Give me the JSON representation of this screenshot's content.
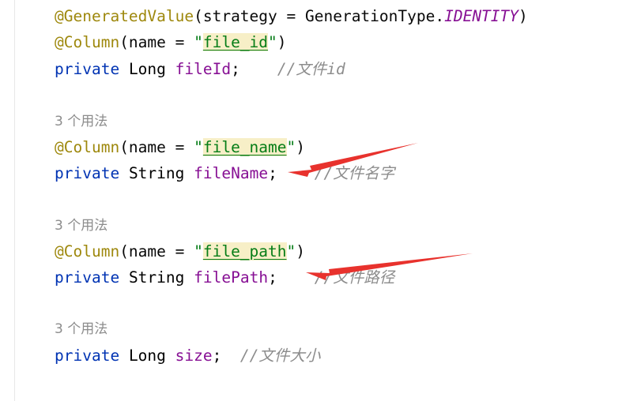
{
  "code": {
    "l1": {
      "annotation": "@GeneratedValue",
      "open": "(strategy = GenerationType.",
      "constant": "IDENTITY",
      "close": ")"
    },
    "l2": {
      "annotation": "@Column",
      "open": "(name = ",
      "q1": "\"",
      "value": "file_id",
      "q2": "\"",
      "close": ")"
    },
    "l3": {
      "keyword": "private",
      "type": "Long",
      "field": "fileId",
      "semicolon": ";",
      "comment": "//文件id"
    },
    "h1": "3 个用法",
    "l4": {
      "annotation": "@Column",
      "open": "(name = ",
      "q1": "\"",
      "value": "file_name",
      "q2": "\"",
      "close": ")"
    },
    "l5": {
      "keyword": "private",
      "type": "String",
      "field": "fileName",
      "semicolon": ";",
      "comment": "//文件名字"
    },
    "h2": "3 个用法",
    "l6": {
      "annotation": "@Column",
      "open": "(name = ",
      "q1": "\"",
      "value": "file_path",
      "q2": "\"",
      "close": ")"
    },
    "l7": {
      "keyword": "private",
      "type": "String",
      "field": "filePath",
      "semicolon": ";",
      "comment": "//文件路径"
    },
    "h3": "3 个用法",
    "l8": {
      "keyword": "private",
      "type": "Long",
      "field": "size",
      "semicolon": ";",
      "comment": "//文件大小"
    }
  },
  "colors": {
    "annotation": "#9e880d",
    "keyword": "#0033b3",
    "field": "#871094",
    "string": "#067d17",
    "comment": "#8c8c8c",
    "arrow": "#e8322d"
  }
}
